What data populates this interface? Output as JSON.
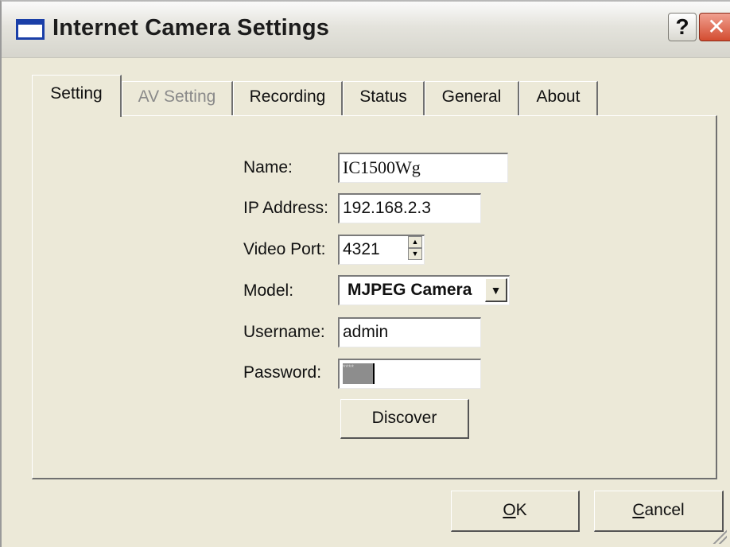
{
  "window": {
    "title": "Internet Camera Settings"
  },
  "titlebar": {
    "help_label": "?",
    "close_label": "✕"
  },
  "tabs": [
    {
      "label": "Setting",
      "state": "active"
    },
    {
      "label": "AV Setting",
      "state": "disabled"
    },
    {
      "label": "Recording",
      "state": "normal"
    },
    {
      "label": "Status",
      "state": "normal"
    },
    {
      "label": "General",
      "state": "normal"
    },
    {
      "label": "About",
      "state": "normal"
    }
  ],
  "form": {
    "name_label": "Name:",
    "name_value": "IC1500Wg",
    "ip_label": "IP Address:",
    "ip_value": "192.168.2.3",
    "port_label": "Video Port:",
    "port_value": "4321",
    "model_label": "Model:",
    "model_value": "MJPEG Camera",
    "username_label": "Username:",
    "username_value": "admin",
    "password_label": "Password:",
    "password_value": "****",
    "discover_label": "Discover"
  },
  "footer": {
    "ok_mnemonic": "O",
    "ok_rest": "K",
    "cancel_mnemonic": "C",
    "cancel_rest": "ancel"
  },
  "icons": [
    "window-icon",
    "help-icon",
    "close-icon",
    "spin-up-icon",
    "spin-down-icon",
    "dropdown-arrow-icon",
    "resize-grip-icon"
  ]
}
